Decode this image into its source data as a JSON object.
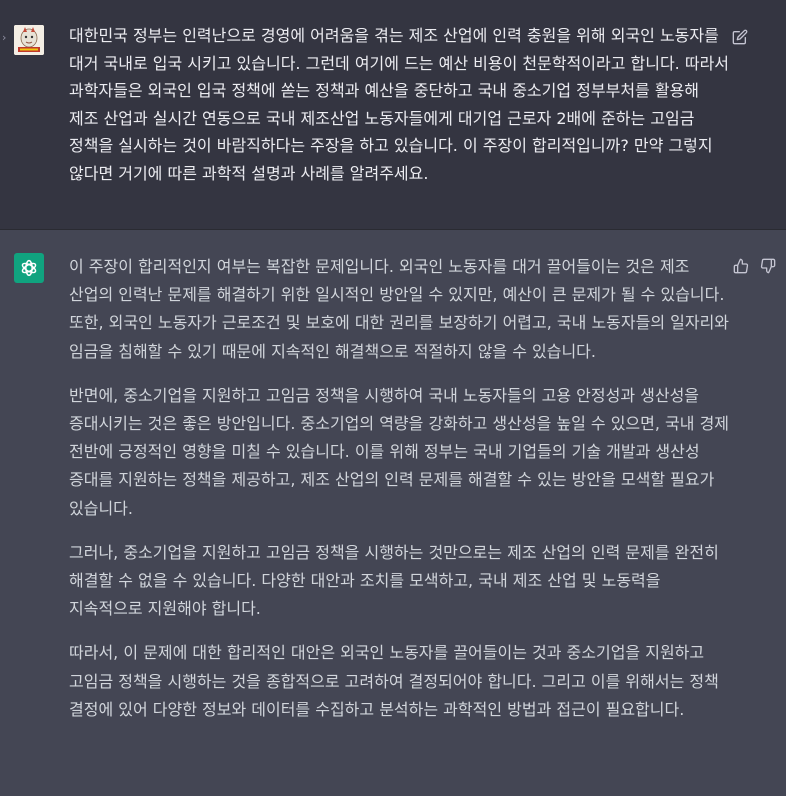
{
  "user_message": {
    "text": "대한민국 정부는 인력난으로 경영에 어려움을 겪는 제조 산업에 인력 충원을 위해 외국인 노동자를 대거 국내로 입국 시키고 있습니다. 그런데 여기에 드는 예산 비용이 천문학적이라고 합니다. 따라서 과학자들은 외국인 입국 정책에 쏟는 정책과 예산을 중단하고 국내 중소기업 정부부처를 활용해 제조 산업과 실시간 연동으로 국내 제조산업 노동자들에게 대기업 근로자 2배에 준하는 고임금 정책을 실시하는 것이 바람직하다는 주장을 하고 있습니다. 이 주장이 합리적입니까? 만약 그렇지 않다면 거기에 따른 과학적 설명과 사례를 알려주세요.",
    "avatar_icon": "user-avatar-image",
    "edit_icon": "edit-pencil-icon"
  },
  "assistant_message": {
    "avatar_icon": "openai-logo-icon",
    "paragraphs": [
      "이 주장이 합리적인지 여부는 복잡한 문제입니다. 외국인 노동자를 대거 끌어들이는 것은 제조 산업의 인력난 문제를 해결하기 위한 일시적인 방안일 수 있지만, 예산이 큰 문제가 될 수 있습니다. 또한, 외국인 노동자가 근로조건 및 보호에 대한 권리를 보장하기 어렵고, 국내 노동자들의 일자리와 임금을 침해할 수 있기 때문에 지속적인 해결책으로 적절하지 않을 수 있습니다.",
      "반면에, 중소기업을 지원하고 고임금 정책을 시행하여 국내 노동자들의 고용 안정성과 생산성을 증대시키는 것은 좋은 방안입니다. 중소기업의 역량을 강화하고 생산성을 높일 수 있으면, 국내 경제 전반에 긍정적인 영향을 미칠 수 있습니다. 이를 위해 정부는 국내 기업들의 기술 개발과 생산성 증대를 지원하는 정책을 제공하고, 제조 산업의 인력 문제를 해결할 수 있는 방안을 모색할 필요가 있습니다.",
      "그러나, 중소기업을 지원하고 고임금 정책을 시행하는 것만으로는 제조 산업의 인력 문제를 완전히 해결할 수 없을 수 있습니다. 다양한 대안과 조치를 모색하고, 국내 제조 산업 및 노동력을 지속적으로 지원해야 합니다.",
      "따라서, 이 문제에 대한 합리적인 대안은 외국인 노동자를 끌어들이는 것과 중소기업을 지원하고 고임금 정책을 시행하는 것을 종합적으로 고려하여 결정되어야 합니다. 그리고 이를 위해서는 정책 결정에 있어 다양한 정보와 데이터를 수집하고 분석하는 과학적인 방법과 접근이 필요합니다."
    ],
    "thumbs_up_icon": "thumbs-up-icon",
    "thumbs_down_icon": "thumbs-down-icon"
  },
  "colors": {
    "user_bg": "#343541",
    "assistant_bg": "#444654",
    "brand_green": "#10a37f",
    "text": "#ececf1",
    "icon": "#c5c5d2"
  }
}
